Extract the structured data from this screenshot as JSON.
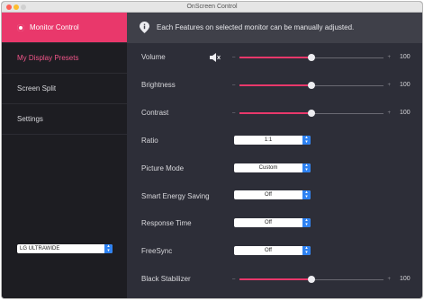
{
  "window": {
    "title": "OnScreen Control"
  },
  "sidebar": {
    "items": [
      {
        "label": "Monitor Control"
      },
      {
        "label": "My Display Presets"
      },
      {
        "label": "Screen Split"
      },
      {
        "label": "Settings"
      }
    ],
    "monitor_select": {
      "value": "LG ULTRAWIDE"
    }
  },
  "info": {
    "text": "Each Features on selected monitor can be manually adjusted."
  },
  "controls": {
    "volume": {
      "label": "Volume",
      "min_mark": "–",
      "max_mark": "+",
      "value": 100,
      "level_fraction": 0.5
    },
    "brightness": {
      "label": "Brightness",
      "min_mark": "–",
      "max_mark": "+",
      "value": 100,
      "level_fraction": 0.5
    },
    "contrast": {
      "label": "Contrast",
      "min_mark": "–",
      "max_mark": "+",
      "value": 100,
      "level_fraction": 0.5
    },
    "ratio": {
      "label": "Ratio",
      "selected": "1:1"
    },
    "picture_mode": {
      "label": "Picture Mode",
      "selected": "Custom"
    },
    "smart_energy_saving": {
      "label": "Smart Energy Saving",
      "selected": "Off"
    },
    "response_time": {
      "label": "Response Time",
      "selected": "Off"
    },
    "freesync": {
      "label": "FreeSync",
      "selected": "Off"
    },
    "black_stabilizer": {
      "label": "Black Stabilizer",
      "min_mark": "–",
      "max_mark": "+",
      "value": 100,
      "level_fraction": 0.5
    }
  },
  "icons": {
    "info": "info-location-icon",
    "speaker": "speaker-muted-icon",
    "dropdown": "chevron-updown-icon"
  },
  "colors": {
    "accent": "#e9386b",
    "sidebar": "#1d1d22",
    "panel": "#2d2e38",
    "select_arrow": "#2e82f2"
  }
}
